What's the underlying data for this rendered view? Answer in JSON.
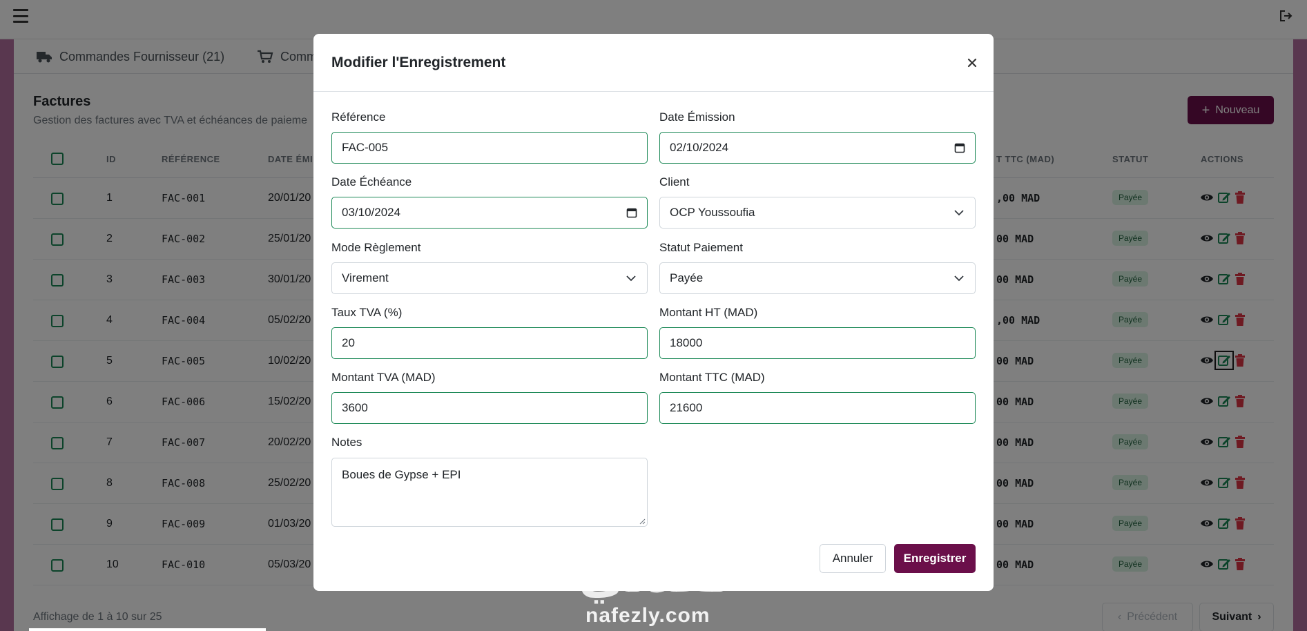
{
  "colors": {
    "primary": "#6b0f4a",
    "success_border": "#198754",
    "badge_bg": "#d9f2e3",
    "badge_text": "#1d5e3a",
    "view_icon": "#212529",
    "edit_icon": "#198754",
    "delete_icon": "#dc3545"
  },
  "tabs": [
    {
      "label": "Commandes Fournisseur (21)",
      "icon": "truck-icon"
    },
    {
      "label": "Comm",
      "icon": "cart-icon"
    }
  ],
  "section": {
    "title": "Factures",
    "subtitle": "Gestion des factures avec TVA et échéances de paieme",
    "new_button": "Nouveau"
  },
  "table": {
    "headers": {
      "id": "ID",
      "reference": "RÉFÉRENCE",
      "date": "DATE ÉMI",
      "ttc": "T TTC (MAD)",
      "status": "STATUT",
      "actions": "ACTIONS"
    },
    "rows": [
      {
        "id": "1",
        "ref": "FAC-001",
        "date": "20/01/20",
        "ttc": ",00 MAD",
        "status": "Payée"
      },
      {
        "id": "2",
        "ref": "FAC-002",
        "date": "25/01/20",
        "ttc": "00 MAD",
        "status": "Payée"
      },
      {
        "id": "3",
        "ref": "FAC-003",
        "date": "30/01/20",
        "ttc": "00 MAD",
        "status": "Payée"
      },
      {
        "id": "4",
        "ref": "FAC-004",
        "date": "05/02/20",
        "ttc": ",00 MAD",
        "status": "Payée"
      },
      {
        "id": "5",
        "ref": "FAC-005",
        "date": "10/02/20",
        "ttc": "00 MAD",
        "status": "Payée"
      },
      {
        "id": "6",
        "ref": "FAC-006",
        "date": "15/02/20",
        "ttc": "00 MAD",
        "status": "Payée"
      },
      {
        "id": "7",
        "ref": "FAC-007",
        "date": "20/02/20",
        "ttc": "00 MAD",
        "status": "Payée"
      },
      {
        "id": "8",
        "ref": "FAC-008",
        "date": "25/02/20",
        "ttc": "00 MAD",
        "status": "Payée"
      },
      {
        "id": "9",
        "ref": "FAC-009",
        "date": "01/03/20",
        "ttc": "00 MAD",
        "status": "Payée"
      },
      {
        "id": "10",
        "ref": "FAC-010",
        "date": "05/03/20",
        "ttc": "00 MAD",
        "status": "Payée"
      }
    ]
  },
  "pagination": {
    "info": "Affichage de 1 à 10 sur 25",
    "prev": "Précédent",
    "next": "Suivant"
  },
  "modal": {
    "title": "Modifier l'Enregistrement",
    "fields": {
      "reference": {
        "label": "Référence",
        "value": "FAC-005"
      },
      "date_emission": {
        "label": "Date Émission",
        "value": "02/10/2024"
      },
      "date_echeance": {
        "label": "Date Échéance",
        "value": "03/10/2024"
      },
      "client": {
        "label": "Client",
        "value": "OCP Youssoufia"
      },
      "mode_reglement": {
        "label": "Mode Règlement",
        "value": "Virement"
      },
      "statut_paiement": {
        "label": "Statut Paiement",
        "value": "Payée"
      },
      "taux_tva": {
        "label": "Taux TVA (%)",
        "value": "20"
      },
      "montant_ht": {
        "label": "Montant HT (MAD)",
        "value": "18000"
      },
      "montant_tva": {
        "label": "Montant TVA (MAD)",
        "value": "3600"
      },
      "montant_ttc": {
        "label": "Montant TTC (MAD)",
        "value": "21600"
      },
      "notes": {
        "label": "Notes",
        "value": "Boues de Gypse + EPI"
      }
    },
    "cancel_label": "Annuler",
    "save_label": "Enregistrer"
  },
  "watermark": {
    "arabic": "نفذلي",
    "latin": "nafezly.com"
  }
}
